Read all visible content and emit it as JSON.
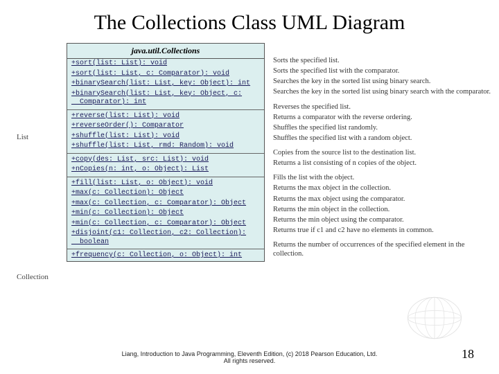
{
  "title": "The Collections Class UML Diagram",
  "sideLabels": {
    "list": "List",
    "collection": "Collection"
  },
  "umlHeader": "java.util.Collections",
  "methods": {
    "m0": "+sort(list: List): void",
    "m1": "+sort(list: List, c: Comparator): void",
    "m2": "+binarySearch(list: List, key: Object): int",
    "m3": "+binarySearch(list: List, key: Object, c:\n  Comparator): int",
    "m4": "+reverse(list: List): void",
    "m5": "+reverseOrder(): Comparator",
    "m6": "+shuffle(list: List): void",
    "m7": "+shuffle(list: List, rmd: Random): void",
    "m8": "+copy(des: List, src: List): void",
    "m9": "+nCopies(n: int, o: Object): List",
    "m10": "+fill(list: List, o: Object): void",
    "m11": "+max(c: Collection): Object",
    "m12": "+max(c: Collection, c: Comparator): Object",
    "m13": "+min(c: Collection): Object",
    "m14": "+min(c: Collection, c: Comparator): Object",
    "m15": "+disjoint(c1: Collection, c2: Collection):\n  boolean",
    "m16": "+frequency(c: Collection, o: Object): int"
  },
  "desc": {
    "d0": "Sorts the specified list.",
    "d1": "Sorts the specified list with the comparator.",
    "d2": "Searches the key in the sorted list using binary search.",
    "d3": "Searches the key in the sorted list using binary search with the comparator.",
    "d4": "Reverses the specified list.",
    "d5": "Returns a comparator with the reverse ordering.",
    "d6": "Shuffles the specified list randomly.",
    "d7": "Shuffles the specified list with a random object.",
    "d8": "Copies from the source list to the destination list.",
    "d9": "Returns a list consisting of n copies of the object.",
    "d10": "Fills the list with the object.",
    "d11": "Returns the max object in the collection.",
    "d12": "Returns the max object using the comparator.",
    "d13": "Returns the min object in the collection.",
    "d14": "Returns the min object using the comparator.",
    "d15": "Returns true if c1 and c2 have no elements in common.",
    "d16": "Returns the number of occurrences of the specified element in the collection."
  },
  "footer": {
    "line1": "Liang, Introduction to Java Programming, Eleventh Edition, (c) 2018 Pearson Education, Ltd.",
    "line2": "All rights reserved."
  },
  "pageNumber": "18"
}
